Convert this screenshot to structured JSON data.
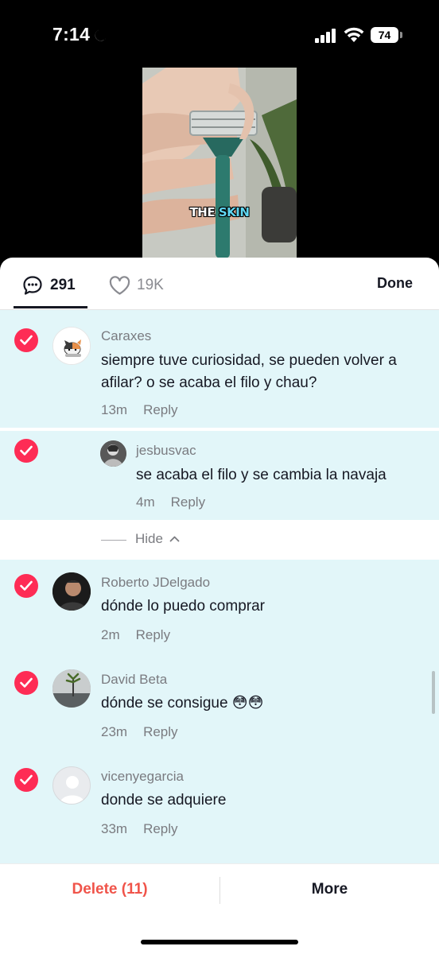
{
  "status_bar": {
    "time": "7:14",
    "battery": "74"
  },
  "video": {
    "caption_part1": "THE",
    "caption_part2": "SKIN"
  },
  "tabs": {
    "comments_count": "291",
    "likes_count": "19K",
    "done_label": "Done"
  },
  "comments": [
    {
      "username": "Caraxes",
      "text": "siempre tuve curiosidad, se pueden volver a afilar? o se acaba el filo y chau?",
      "time": "13m",
      "reply_label": "Reply"
    },
    {
      "username": "jesbusvac",
      "text": "se acaba el filo y se cambia la navaja",
      "time": "4m",
      "reply_label": "Reply"
    },
    {
      "username": "Roberto JDelgado",
      "text": "dónde lo puedo comprar",
      "time": "2m",
      "reply_label": "Reply"
    },
    {
      "username": "David Beta",
      "text": "dónde se consigue 😳😳",
      "time": "23m",
      "reply_label": "Reply"
    },
    {
      "username": "vicenyegarcia",
      "text": "donde se adquiere",
      "time": "33m",
      "reply_label": "Reply"
    }
  ],
  "hide_label": "Hide",
  "bottom_bar": {
    "delete_label": "Delete (11)",
    "more_label": "More"
  },
  "colors": {
    "accent_red": "#fe2c55",
    "delete_red": "#f0544a",
    "selected_bg": "#e2f6f9"
  }
}
